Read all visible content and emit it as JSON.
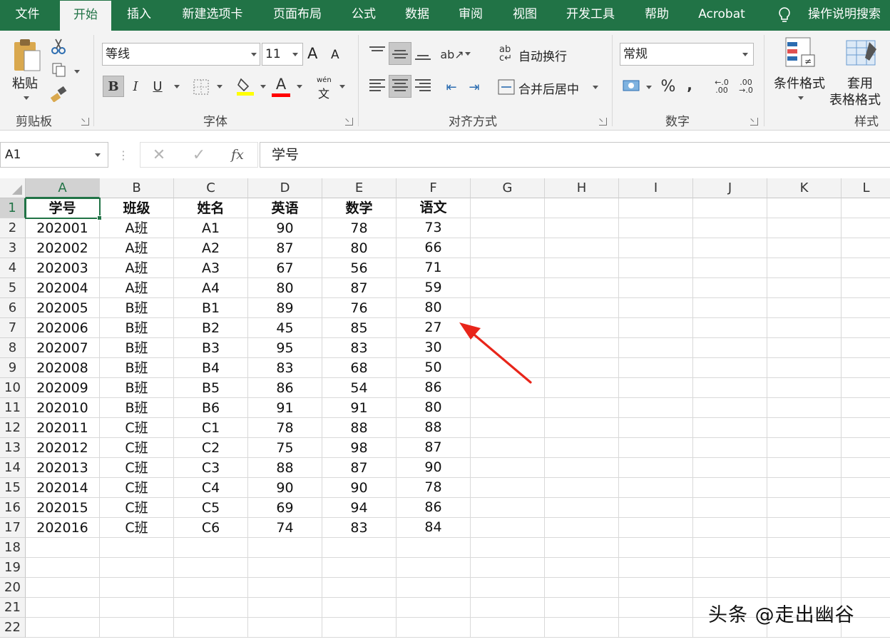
{
  "tabs": [
    "文件",
    "开始",
    "插入",
    "新建选项卡",
    "页面布局",
    "公式",
    "数据",
    "审阅",
    "视图",
    "开发工具",
    "帮助",
    "Acrobat"
  ],
  "active_tab": "开始",
  "tell_me": "操作说明搜索",
  "ribbon": {
    "clipboard": {
      "paste": "粘贴",
      "label": "剪贴板"
    },
    "font": {
      "name": "等线",
      "size": "11",
      "grow": "A",
      "shrink": "A",
      "bold": "B",
      "italic": "I",
      "underline": "U",
      "phonetic_top": "wén",
      "phonetic_bottom": "文",
      "label": "字体",
      "fill_color": "#ffff00",
      "font_color": "#ff0000"
    },
    "alignment": {
      "wrap": "自动换行",
      "merge": "合并后居中",
      "label": "对齐方式"
    },
    "number": {
      "format": "常规",
      "percent": "%",
      "comma": "，",
      "inc_decimal": "←.0 .00",
      "dec_decimal": ".00 →.0",
      "label": "数字"
    },
    "styles": {
      "conditional": "条件格式",
      "table_top": "套用",
      "table_bottom": "表格格式",
      "label": "样式"
    }
  },
  "formula_bar": {
    "name_box": "A1",
    "fx": "fx",
    "content": "学号"
  },
  "columns": [
    "A",
    "B",
    "C",
    "D",
    "E",
    "F",
    "G",
    "H",
    "I",
    "J",
    "K",
    "L"
  ],
  "rows": [
    "1",
    "2",
    "3",
    "4",
    "5",
    "6",
    "7",
    "8",
    "9",
    "10",
    "11",
    "12",
    "13",
    "14",
    "15",
    "16",
    "17",
    "18",
    "19",
    "20",
    "21",
    "22"
  ],
  "table": {
    "headers": [
      "学号",
      "班级",
      "姓名",
      "英语",
      "数学",
      "语文"
    ],
    "rows": [
      [
        "202001",
        "A班",
        "A1",
        "90",
        "78",
        "73"
      ],
      [
        "202002",
        "A班",
        "A2",
        "87",
        "80",
        "66"
      ],
      [
        "202003",
        "A班",
        "A3",
        "67",
        "56",
        "71"
      ],
      [
        "202004",
        "A班",
        "A4",
        "80",
        "87",
        "59"
      ],
      [
        "202005",
        "B班",
        "B1",
        "89",
        "76",
        "80"
      ],
      [
        "202006",
        "B班",
        "B2",
        "45",
        "85",
        "27"
      ],
      [
        "202007",
        "B班",
        "B3",
        "95",
        "83",
        "30"
      ],
      [
        "202008",
        "B班",
        "B4",
        "83",
        "68",
        "50"
      ],
      [
        "202009",
        "B班",
        "B5",
        "86",
        "54",
        "86"
      ],
      [
        "202010",
        "B班",
        "B6",
        "91",
        "91",
        "80"
      ],
      [
        "202011",
        "C班",
        "C1",
        "78",
        "88",
        "88"
      ],
      [
        "202012",
        "C班",
        "C2",
        "75",
        "98",
        "87"
      ],
      [
        "202013",
        "C班",
        "C3",
        "88",
        "87",
        "90"
      ],
      [
        "202014",
        "C班",
        "C4",
        "90",
        "90",
        "78"
      ],
      [
        "202015",
        "C班",
        "C5",
        "69",
        "94",
        "86"
      ],
      [
        "202016",
        "C班",
        "C6",
        "74",
        "83",
        "84"
      ]
    ]
  },
  "watermark": "头条 @走出幽谷",
  "colors": {
    "excel_green": "#217346",
    "arrow_red": "#e8251a"
  }
}
